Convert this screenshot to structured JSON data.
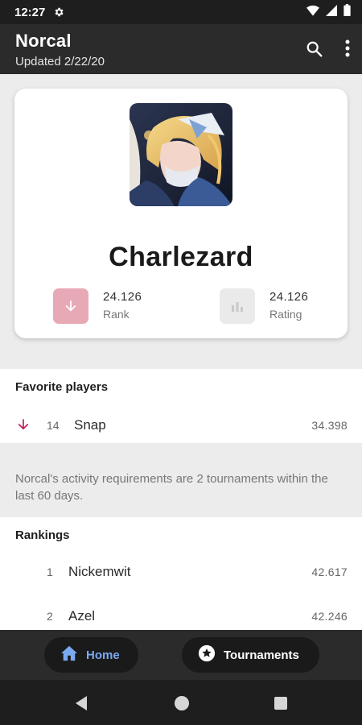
{
  "status_bar": {
    "time": "12:27"
  },
  "app_bar": {
    "title": "Norcal",
    "subtitle": "Updated 2/22/20"
  },
  "profile": {
    "name": "Charlezard",
    "rank": {
      "value": "24.126",
      "label": "Rank"
    },
    "rating": {
      "value": "24.126",
      "label": "Rating"
    }
  },
  "favorites": {
    "title": "Favorite players",
    "players": [
      {
        "rank": "14",
        "name": "Snap",
        "rating": "34.398",
        "trend": "down"
      }
    ]
  },
  "activity_note": "Norcal's activity requirements are 2 tournaments within the last 60 days.",
  "rankings": {
    "title": "Rankings",
    "rows": [
      {
        "rank": "1",
        "name": "Nickemwit",
        "rating": "42.617"
      },
      {
        "rank": "2",
        "name": "Azel",
        "rating": "42.246"
      }
    ]
  },
  "bottom_nav": {
    "home_label": "Home",
    "tournaments_label": "Tournaments"
  },
  "colors": {
    "accent_blue": "#7aa9f0",
    "rank_down": "#c2185b",
    "rank_bg": "#e8a9b6"
  }
}
